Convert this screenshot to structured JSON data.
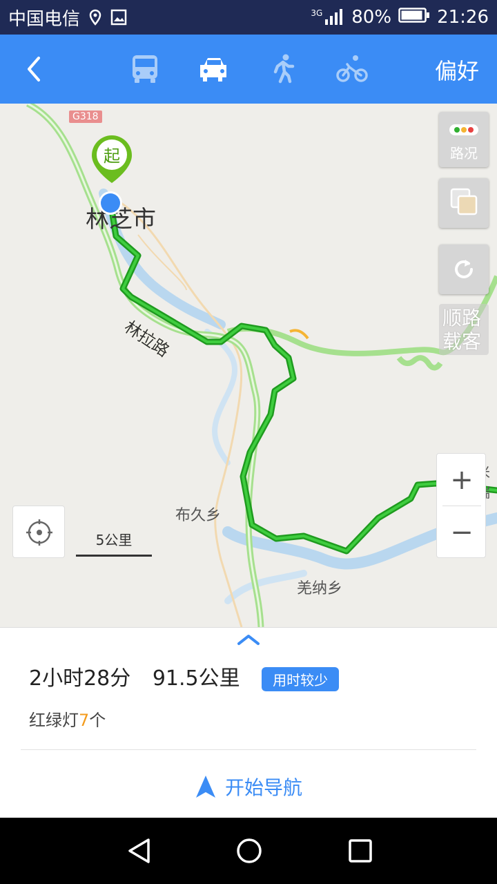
{
  "status": {
    "carrier": "中国电信",
    "network": "3G",
    "battery": "80%",
    "time": "21:26"
  },
  "topbar": {
    "preference_label": "偏好",
    "modes": [
      "bus-icon",
      "car-icon",
      "walk-icon",
      "bike-icon"
    ],
    "active_mode": "car-icon"
  },
  "map": {
    "road_badge": "G318",
    "start_marker": "起",
    "city": "林芝市",
    "road_label": "林拉路",
    "places": [
      "布久乡",
      "羌纳乡"
    ],
    "edge_label": "米瑞",
    "traffic_label": "路况",
    "ride_label_line1": "顺路",
    "ride_label_line2": "载客",
    "scale_label": "5公里",
    "zoom_in": "+",
    "zoom_out": "−"
  },
  "route": {
    "duration": "2小时28分",
    "distance": "91.5公里",
    "badge": "用时较少",
    "lights_prefix": "红绿灯",
    "lights_count": "7",
    "lights_suffix": "个",
    "start_nav": "开始导航"
  },
  "colors": {
    "accent": "#3b8cf5",
    "route": "#22b622",
    "status_bar": "#1f2a55"
  }
}
